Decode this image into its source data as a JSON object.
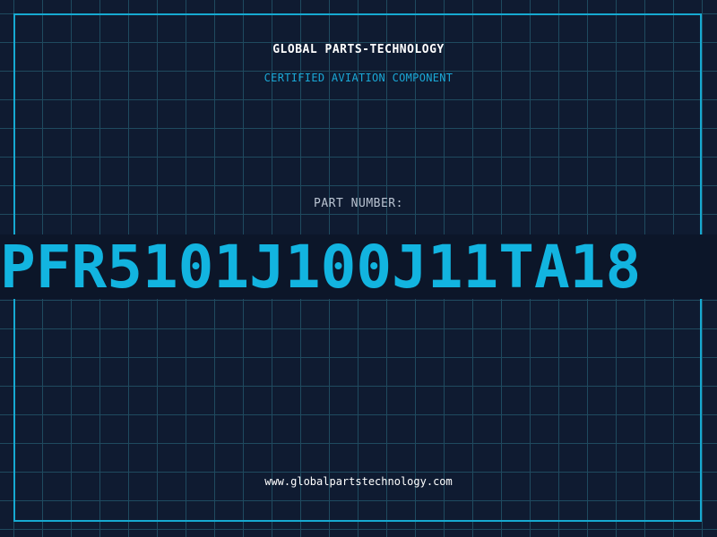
{
  "header": {
    "company": "GLOBAL PARTS-TECHNOLOGY",
    "tagline": "CERTIFIED AVIATION COMPONENT"
  },
  "part": {
    "label": "PART NUMBER:",
    "number": "PFR5101J100J11TA18"
  },
  "footer": {
    "website": "www.globalpartstechnology.com"
  },
  "colors": {
    "background": "#0f1b31",
    "grid": "#1f4a5f",
    "accent": "#16a9d1",
    "part_number": "#12b4e0",
    "band": "#0c1629"
  }
}
